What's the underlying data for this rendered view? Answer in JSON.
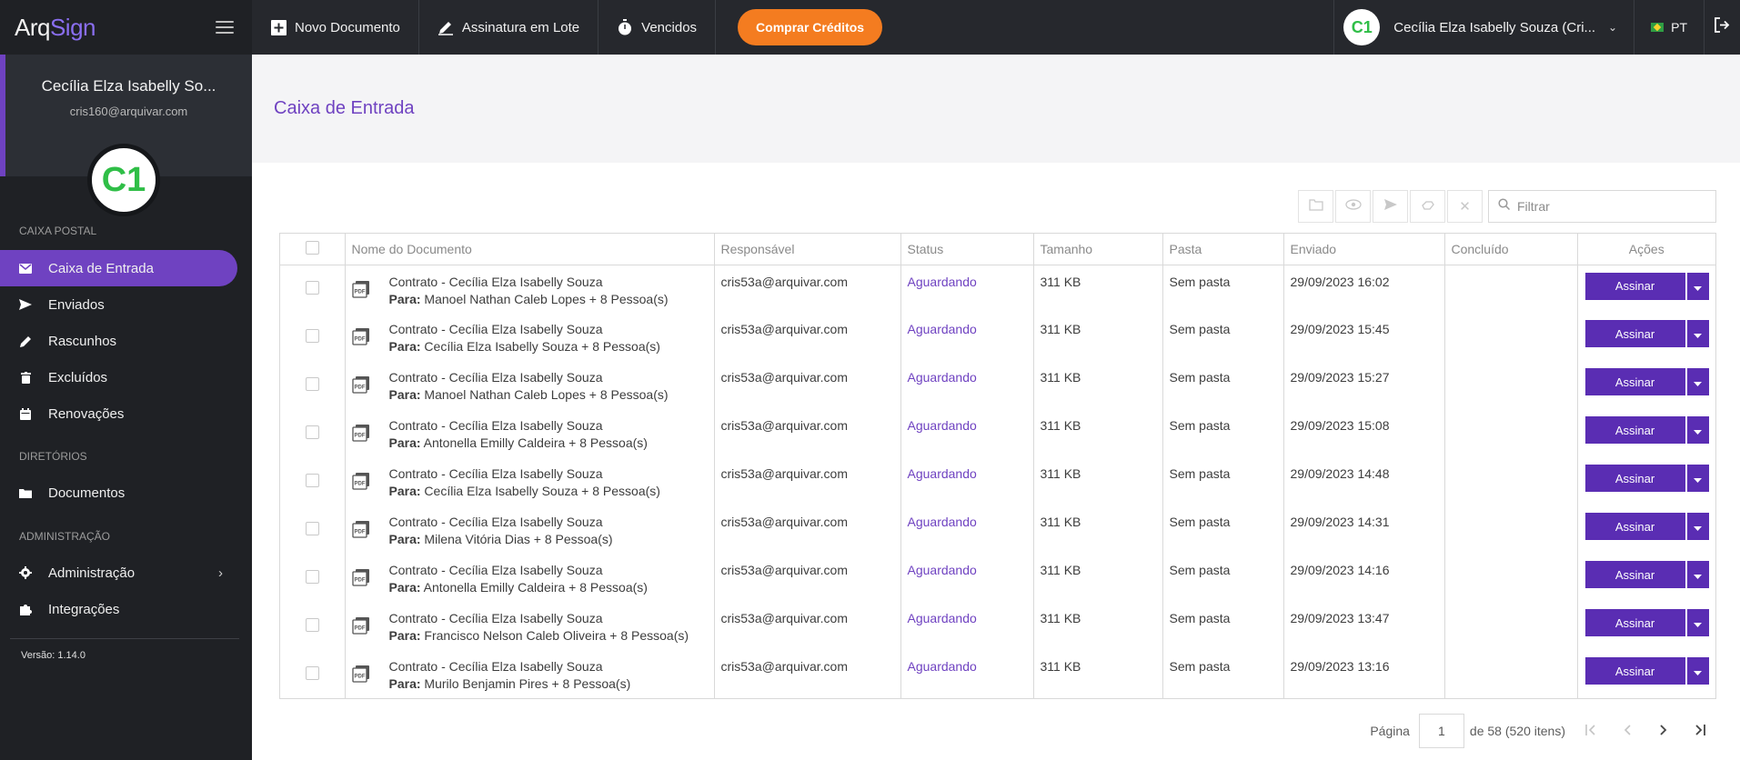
{
  "app": {
    "logo_main": "Arq",
    "logo_accent": "Sign"
  },
  "sidebar": {
    "profile_name": "Cecília Elza Isabelly So...",
    "profile_email": "cris160@arquivar.com",
    "avatar_initials": "C1",
    "sections": {
      "mail": "CAIXA POSTAL",
      "dirs": "DIRETÓRIOS",
      "admin": "ADMINISTRAÇÃO"
    },
    "items": {
      "inbox": "Caixa de Entrada",
      "sent": "Enviados",
      "drafts": "Rascunhos",
      "deleted": "Excluídos",
      "renewals": "Renovações",
      "documents": "Documentos",
      "administration": "Administração",
      "integrations": "Integrações"
    },
    "version": "Versão: 1.14.0"
  },
  "topbar": {
    "new_document": "Novo Documento",
    "batch_sign": "Assinatura em Lote",
    "expired": "Vencidos",
    "buy_credits": "Comprar Créditos",
    "user_name": "Cecília Elza Isabelly Souza (Cri...",
    "avatar_initials": "C1",
    "language": "PT"
  },
  "page": {
    "title": "Caixa de Entrada"
  },
  "filter": {
    "placeholder": "Filtrar"
  },
  "table": {
    "headers": {
      "name": "Nome do Documento",
      "owner": "Responsável",
      "status": "Status",
      "size": "Tamanho",
      "folder": "Pasta",
      "sent": "Enviado",
      "done": "Concluído",
      "actions": "Ações"
    },
    "to_label": "Para:",
    "sign_label": "Assinar",
    "rows": [
      {
        "name": "Contrato - Cecília Elza Isabelly Souza",
        "to": "Manoel Nathan Caleb Lopes + 8 Pessoa(s)",
        "owner": "cris53a@arquivar.com",
        "status": "Aguardando",
        "size": "311 KB",
        "folder": "Sem pasta",
        "sent": "29/09/2023 16:02",
        "done": ""
      },
      {
        "name": "Contrato - Cecília Elza Isabelly Souza",
        "to": "Cecília Elza Isabelly Souza + 8 Pessoa(s)",
        "owner": "cris53a@arquivar.com",
        "status": "Aguardando",
        "size": "311 KB",
        "folder": "Sem pasta",
        "sent": "29/09/2023 15:45",
        "done": ""
      },
      {
        "name": "Contrato - Cecília Elza Isabelly Souza",
        "to": "Manoel Nathan Caleb Lopes + 8 Pessoa(s)",
        "owner": "cris53a@arquivar.com",
        "status": "Aguardando",
        "size": "311 KB",
        "folder": "Sem pasta",
        "sent": "29/09/2023 15:27",
        "done": ""
      },
      {
        "name": "Contrato - Cecília Elza Isabelly Souza",
        "to": "Antonella Emilly Caldeira + 8 Pessoa(s)",
        "owner": "cris53a@arquivar.com",
        "status": "Aguardando",
        "size": "311 KB",
        "folder": "Sem pasta",
        "sent": "29/09/2023 15:08",
        "done": ""
      },
      {
        "name": "Contrato - Cecília Elza Isabelly Souza",
        "to": "Cecília Elza Isabelly Souza + 8 Pessoa(s)",
        "owner": "cris53a@arquivar.com",
        "status": "Aguardando",
        "size": "311 KB",
        "folder": "Sem pasta",
        "sent": "29/09/2023 14:48",
        "done": ""
      },
      {
        "name": "Contrato - Cecília Elza Isabelly Souza",
        "to": "Milena Vitória Dias + 8 Pessoa(s)",
        "owner": "cris53a@arquivar.com",
        "status": "Aguardando",
        "size": "311 KB",
        "folder": "Sem pasta",
        "sent": "29/09/2023 14:31",
        "done": ""
      },
      {
        "name": "Contrato - Cecília Elza Isabelly Souza",
        "to": "Antonella Emilly Caldeira + 8 Pessoa(s)",
        "owner": "cris53a@arquivar.com",
        "status": "Aguardando",
        "size": "311 KB",
        "folder": "Sem pasta",
        "sent": "29/09/2023 14:16",
        "done": ""
      },
      {
        "name": "Contrato - Cecília Elza Isabelly Souza",
        "to": "Francisco Nelson Caleb Oliveira + 8 Pessoa(s)",
        "owner": "cris53a@arquivar.com",
        "status": "Aguardando",
        "size": "311 KB",
        "folder": "Sem pasta",
        "sent": "29/09/2023 13:47",
        "done": ""
      },
      {
        "name": "Contrato - Cecília Elza Isabelly Souza",
        "to": "Murilo Benjamin Pires + 8 Pessoa(s)",
        "owner": "cris53a@arquivar.com",
        "status": "Aguardando",
        "size": "311 KB",
        "folder": "Sem pasta",
        "sent": "29/09/2023 13:16",
        "done": ""
      }
    ]
  },
  "pager": {
    "label": "Página",
    "current": "1",
    "summary": "de 58 (520 itens)"
  },
  "colors": {
    "accent": "#6f42c1",
    "button": "#5a2db3",
    "orange": "#f47c20",
    "sidebar": "#1f2125"
  }
}
